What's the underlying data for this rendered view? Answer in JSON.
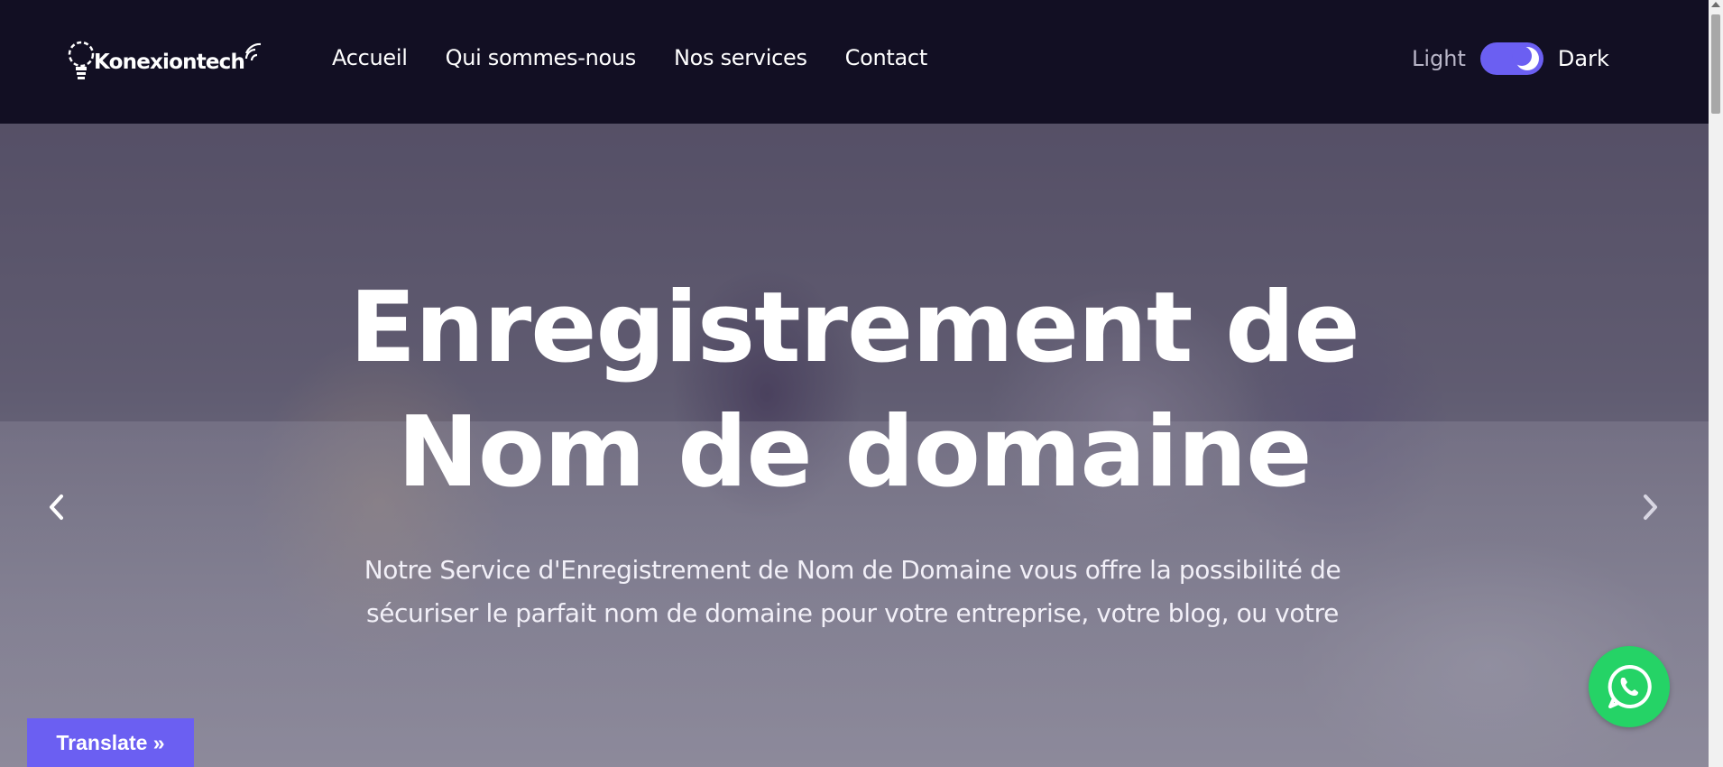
{
  "header": {
    "logo_text": "Konexiontech",
    "nav": [
      "Accueil",
      "Qui sommes-nous",
      "Nos services",
      "Contact"
    ],
    "theme": {
      "light_label": "Light",
      "dark_label": "Dark",
      "mode": "dark"
    }
  },
  "hero": {
    "title_line1": "Enregistrement de",
    "title_line2": "Nom de domaine",
    "description_line1": "Notre Service d'Enregistrement de Nom de Domaine vous offre la possibilité de",
    "description_line2": "sécuriser le parfait nom de domaine pour votre entreprise, votre blog, ou votre"
  },
  "widgets": {
    "translate_label": "Translate »",
    "whatsapp_icon": "whatsapp-icon"
  },
  "colors": {
    "header_bg": "#120f23",
    "accent": "#6b5ff2",
    "whatsapp": "#25d366"
  }
}
